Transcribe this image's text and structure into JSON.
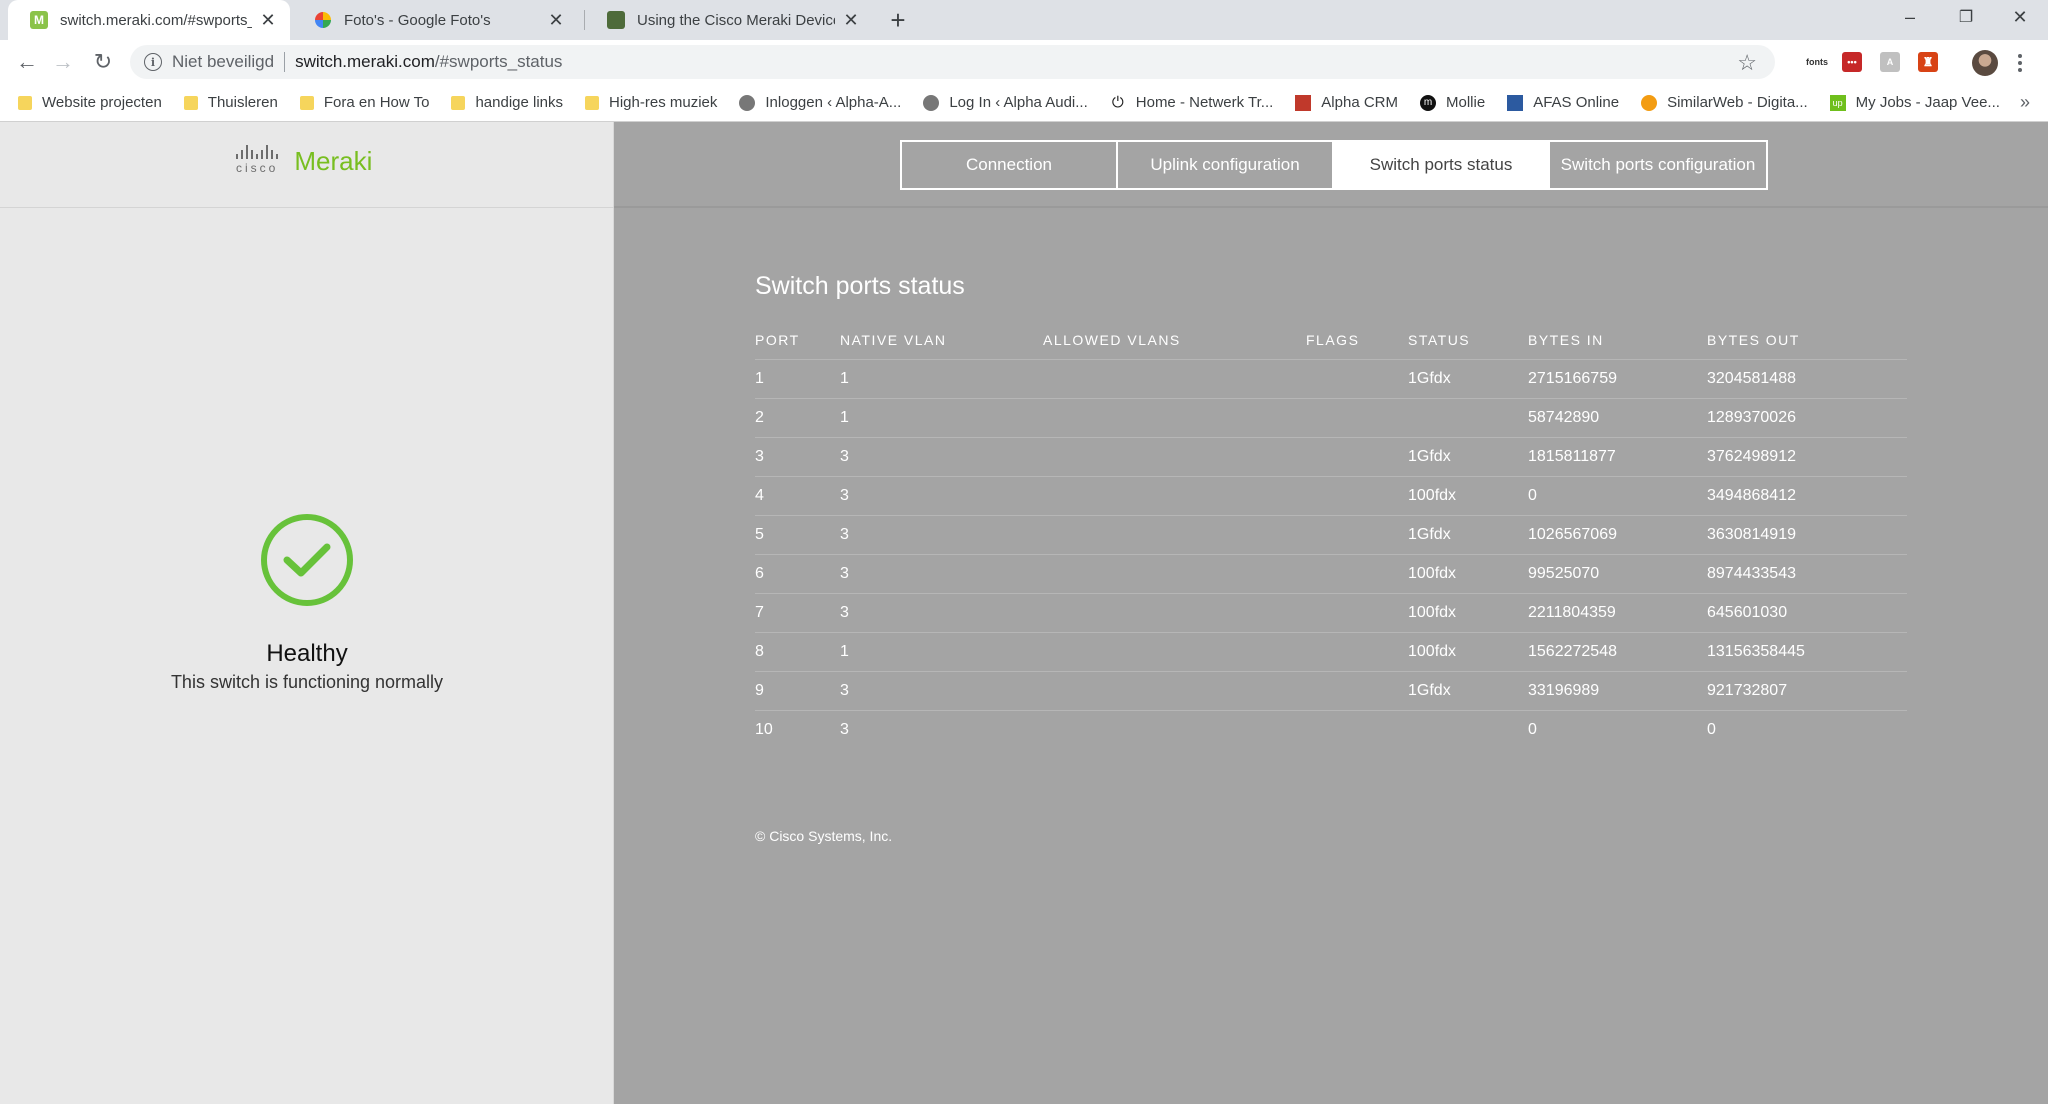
{
  "browser": {
    "tabs": [
      {
        "title": "switch.meraki.com/#swports_status",
        "favicon": "meraki-favicon",
        "favicon_color": "#8bc34a",
        "favicon_letter": "M"
      },
      {
        "title": "Foto's - Google Foto's",
        "favicon": "google-photos-favicon"
      },
      {
        "title": "Using the Cisco Meraki Device Lo",
        "favicon": "doc-favicon",
        "favicon_color": "#4e6b3a"
      }
    ],
    "new_tab_icon": "+",
    "window_controls": {
      "minimize": "–",
      "restore": "❐",
      "close": "✕"
    },
    "address": {
      "security_label": "Niet beveiligd",
      "host": "switch.meraki.com",
      "path": "/#swports_status"
    },
    "extensions": [
      {
        "name": "fonts-extension",
        "label": "fonts"
      },
      {
        "name": "lastpass-extension",
        "label": "•••",
        "color": "#c62828"
      },
      {
        "name": "extension-gray",
        "label": "A",
        "color": "#c0c0c0"
      },
      {
        "name": "extension-orange",
        "label": "♜",
        "color": "#d84315"
      }
    ],
    "bookmarks": [
      {
        "label": "Website projecten",
        "icon": "folder-icon"
      },
      {
        "label": "Thuisleren",
        "icon": "folder-icon"
      },
      {
        "label": "Fora en How To",
        "icon": "folder-icon"
      },
      {
        "label": "handige links",
        "icon": "folder-icon"
      },
      {
        "label": "High-res muziek",
        "icon": "folder-icon"
      },
      {
        "label": "Inloggen ‹ Alpha-A...",
        "icon": "site-icon",
        "color": "#777777"
      },
      {
        "label": "Log In ‹ Alpha Audi...",
        "icon": "site-icon",
        "color": "#777777"
      },
      {
        "label": "Home - Netwerk Tr...",
        "icon": "power-icon",
        "color": "#222222"
      },
      {
        "label": "Alpha CRM",
        "icon": "site-icon",
        "color": "#c0392b"
      },
      {
        "label": "Mollie",
        "icon": "site-icon",
        "color": "#111111"
      },
      {
        "label": "AFAS Online",
        "icon": "site-icon",
        "color": "#2c5aa0"
      },
      {
        "label": "SimilarWeb - Digita...",
        "icon": "site-icon",
        "color": "#f39c12"
      },
      {
        "label": "My Jobs - Jaap Vee...",
        "icon": "site-icon",
        "color": "#6fbf1c"
      }
    ],
    "bookmarks_overflow": "»"
  },
  "brand": {
    "cisco": "cisco",
    "meraki": "Meraki",
    "accent": "#78be20"
  },
  "health": {
    "status": "Healthy",
    "message": "This switch is functioning normally",
    "color": "#67c23a"
  },
  "nav": {
    "tabs": [
      {
        "label": "Connection",
        "active": false
      },
      {
        "label": "Uplink configuration",
        "active": false
      },
      {
        "label": "Switch ports status",
        "active": true
      },
      {
        "label": "Switch ports configuration",
        "active": false
      }
    ]
  },
  "ports": {
    "title": "Switch ports status",
    "columns": [
      "PORT",
      "NATIVE VLAN",
      "ALLOWED VLANS",
      "FLAGS",
      "STATUS",
      "BYTES IN",
      "BYTES OUT"
    ],
    "rows": [
      {
        "port": "1",
        "native_vlan": "1",
        "allowed_vlans": "",
        "flags": "",
        "status": "1Gfdx",
        "bytes_in": "2715166759",
        "bytes_out": "3204581488"
      },
      {
        "port": "2",
        "native_vlan": "1",
        "allowed_vlans": "",
        "flags": "",
        "status": "",
        "bytes_in": "58742890",
        "bytes_out": "1289370026"
      },
      {
        "port": "3",
        "native_vlan": "3",
        "allowed_vlans": "",
        "flags": "",
        "status": "1Gfdx",
        "bytes_in": "1815811877",
        "bytes_out": "3762498912"
      },
      {
        "port": "4",
        "native_vlan": "3",
        "allowed_vlans": "",
        "flags": "",
        "status": "100fdx",
        "bytes_in": "0",
        "bytes_out": "3494868412"
      },
      {
        "port": "5",
        "native_vlan": "3",
        "allowed_vlans": "",
        "flags": "",
        "status": "1Gfdx",
        "bytes_in": "1026567069",
        "bytes_out": "3630814919"
      },
      {
        "port": "6",
        "native_vlan": "3",
        "allowed_vlans": "",
        "flags": "",
        "status": "100fdx",
        "bytes_in": "99525070",
        "bytes_out": "8974433543"
      },
      {
        "port": "7",
        "native_vlan": "3",
        "allowed_vlans": "",
        "flags": "",
        "status": "100fdx",
        "bytes_in": "2211804359",
        "bytes_out": "645601030"
      },
      {
        "port": "8",
        "native_vlan": "1",
        "allowed_vlans": "",
        "flags": "",
        "status": "100fdx",
        "bytes_in": "1562272548",
        "bytes_out": "13156358445"
      },
      {
        "port": "9",
        "native_vlan": "3",
        "allowed_vlans": "",
        "flags": "",
        "status": "1Gfdx",
        "bytes_in": "33196989",
        "bytes_out": "921732807"
      },
      {
        "port": "10",
        "native_vlan": "3",
        "allowed_vlans": "",
        "flags": "",
        "status": "",
        "bytes_in": "0",
        "bytes_out": "0"
      }
    ]
  },
  "footer": "© Cisco Systems, Inc."
}
